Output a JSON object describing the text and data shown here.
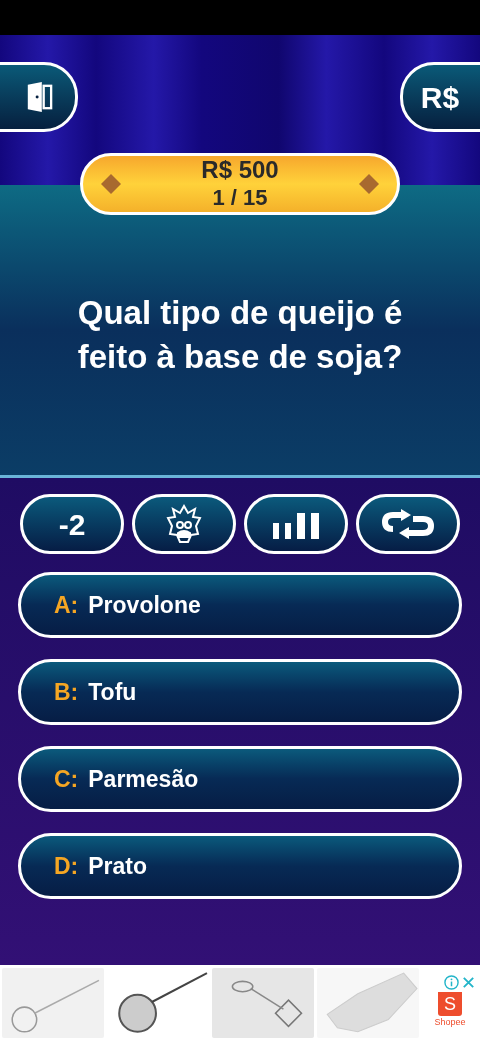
{
  "top_buttons": {
    "currency": "R$"
  },
  "prize": {
    "amount": "R$ 500",
    "progress": "1 / 15"
  },
  "question": "Qual tipo de queijo é feito à base de soja?",
  "lifelines": [
    {
      "kind": "text",
      "label": "-2"
    },
    {
      "kind": "expert"
    },
    {
      "kind": "audience"
    },
    {
      "kind": "swap"
    }
  ],
  "answers": [
    {
      "letter": "A:",
      "text": "Provolone"
    },
    {
      "letter": "B:",
      "text": "Tofu"
    },
    {
      "letter": "C:",
      "text": "Parmesão"
    },
    {
      "letter": "D:",
      "text": "Prato"
    }
  ],
  "ad": {
    "logo_letter": "S",
    "brand": "Shopee"
  }
}
